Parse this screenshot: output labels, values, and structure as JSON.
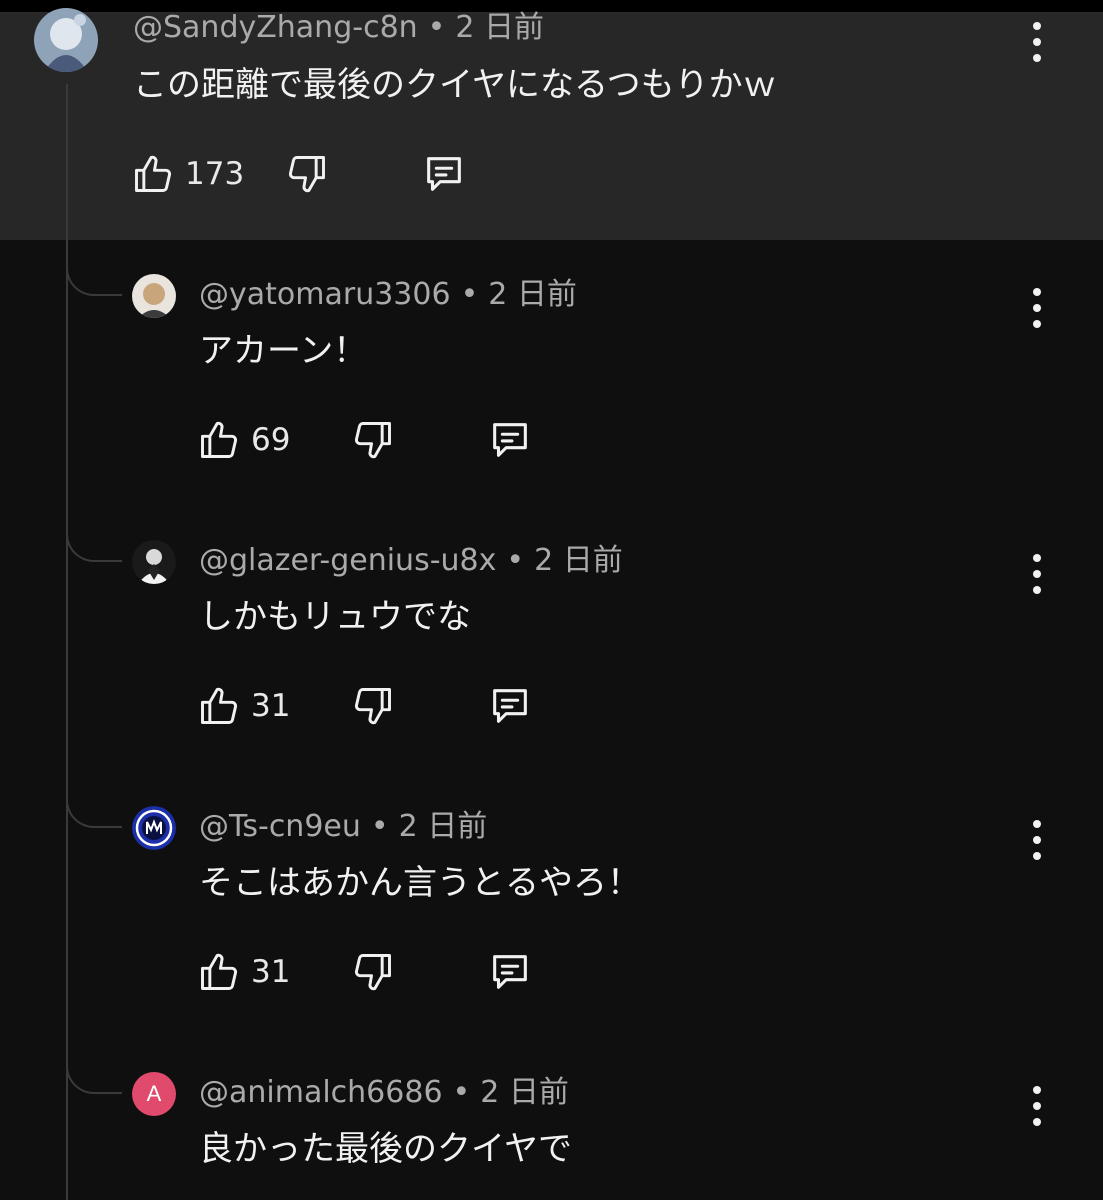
{
  "comments": [
    {
      "username": "@SandyZhang-c8n",
      "separator": "•",
      "time": "2 日前",
      "text": "この距離で最後のクイヤになるつもりかｗ",
      "likes": "173"
    },
    {
      "username": "@yatomaru3306",
      "separator": "•",
      "time": "2 日前",
      "text": "アカーン！",
      "likes": "69"
    },
    {
      "username": "@glazer-genius-u8x",
      "separator": "•",
      "time": "2 日前",
      "text": "しかもリュウでな",
      "likes": "31"
    },
    {
      "username": "@Ts-cn9eu",
      "separator": "•",
      "time": "2 日前",
      "text": "そこはあかん言うとるやろ！",
      "likes": "31"
    },
    {
      "username": "@animalch6686",
      "separator": "•",
      "time": "2 日前",
      "text": "良かった最後のクイヤで",
      "avatar_letter": "A"
    }
  ],
  "icons": {
    "like": "thumbs-up-icon",
    "dislike": "thumbs-down-icon",
    "reply": "reply-icon",
    "more": "more-vert-icon"
  },
  "colors": {
    "background": "#0f0f0f",
    "highlight": "#272727",
    "text": "#f1f1f1",
    "meta": "#aaaaaa",
    "avatar_a": "#e04a6c"
  }
}
